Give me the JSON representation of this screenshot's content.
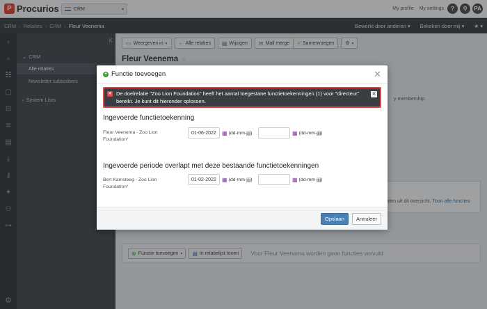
{
  "app": {
    "logo_mark": "P",
    "logo_text": "Procurios",
    "module_select": "CRM"
  },
  "topbar": {
    "links": [
      "My profile",
      "My settings"
    ],
    "icons": [
      "?",
      "⚲",
      "PA"
    ]
  },
  "breadcrumb": {
    "items": [
      "CRM",
      "Relaties",
      "CRM"
    ],
    "current": "Fleur Veenema",
    "right": [
      "Bewerkt door anderen",
      "Bekeken door mij"
    ]
  },
  "sidebar": {
    "collapse": "K",
    "section_crm": "CRM",
    "items": [
      {
        "label": "Alle relaties"
      },
      {
        "label": "Newsletter subscribers"
      }
    ],
    "section_system": "System Lists"
  },
  "toolbar": {
    "weergeven": "Weergeven in",
    "alle_relaties": "Alle relaties",
    "wijzigen": "Wijzigen",
    "mail_merge": "Mail merge",
    "samenvoegen": "Samenvoegen"
  },
  "page": {
    "title": "Fleur Veenema",
    "behind_membership": "y membership.",
    "behind_overview": "platen uit dit overzicht.",
    "behind_overview_link": "Toon alle functies",
    "functie_toevoegen": "Functie toevoegen",
    "in_relatielijst": "In relatielijst tonen",
    "empty_message": "Voor Fleur Veenema worden geen functies vervuld"
  },
  "modal": {
    "title": "Functie toevoegen",
    "alert": "De doelrelatie \"Zoo Lion Foundation\" heeft het aantal toegestane functietoekenningen (1) voor \"directeur\" bereikt. Je kunt dit hieronder oplossen.",
    "section1_title": "Ingevoerde functietoekenning",
    "row1_label": "Fleur Veenema - Zoo Lion Foundation",
    "row1_start": "01-06-2022",
    "row1_end": "",
    "date_hint": "(dd-mm-jjjj)",
    "section2_title": "Ingevoerde periode overlapt met deze bestaande functietoekenningen",
    "row2_label": "Bert Kamsteeg - Zoo Lion Foundation",
    "row2_start": "01-02-2022",
    "row2_end": "",
    "save_label": "Opslaan",
    "cancel_label": "Annuleer"
  }
}
